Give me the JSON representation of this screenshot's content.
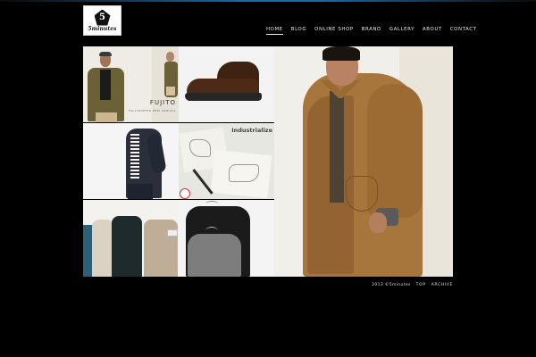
{
  "logo": {
    "mark": "5",
    "name": "5minutes"
  },
  "nav": {
    "items": [
      {
        "label": "HOME",
        "active": true
      },
      {
        "label": "BLOG"
      },
      {
        "label": "ONLINE SHOP"
      },
      {
        "label": "BRAND"
      },
      {
        "label": "GALLERY"
      },
      {
        "label": "ABOUT"
      },
      {
        "label": "CONTACT"
      }
    ]
  },
  "tiles": {
    "fujito": {
      "brand": "FUJITO",
      "sub": "FALL/WINTER NEW ARRIVAL"
    },
    "industrialize": {
      "title": "Industrialize"
    }
  },
  "footer": {
    "copyright": "2013 ©5minutes",
    "links": [
      "TOP",
      "ARCHIVE"
    ]
  },
  "colors": {
    "background": "#000000",
    "accent_line": "#1e7cc8",
    "nav_text": "#ffffff"
  }
}
